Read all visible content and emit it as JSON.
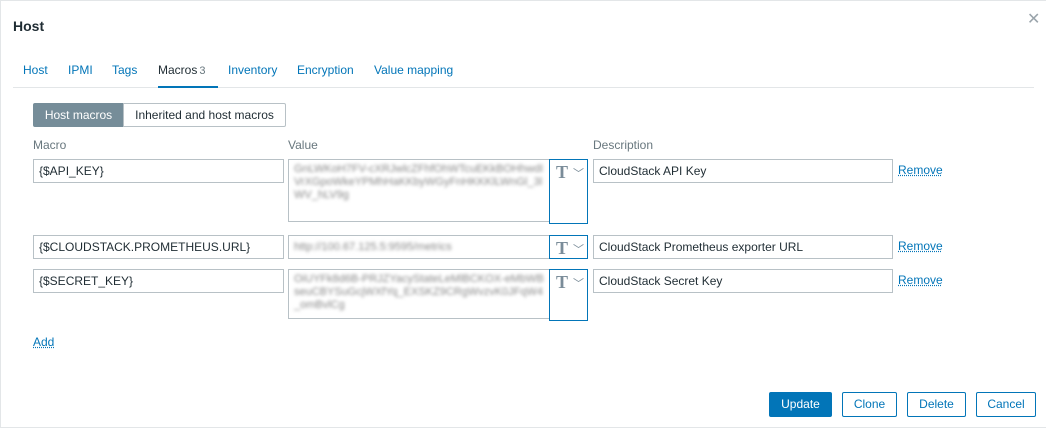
{
  "dialog": {
    "title": "Host"
  },
  "tabs": [
    {
      "label": "Host"
    },
    {
      "label": "IPMI"
    },
    {
      "label": "Tags"
    },
    {
      "label": "Macros",
      "count": "3"
    },
    {
      "label": "Inventory"
    },
    {
      "label": "Encryption"
    },
    {
      "label": "Value mapping"
    }
  ],
  "active_tab": "Macros",
  "segmented": {
    "host_macros": "Host macros",
    "inherited": "Inherited and host macros"
  },
  "columns": {
    "macro": "Macro",
    "value": "Value",
    "description": "Description"
  },
  "macros": [
    {
      "macro": "{$API_KEY}",
      "value": "GnLWKoH7FV-cXRJwlcZFhfOhWTcuEKkBOHhwdIVrXGpoWkeYPMhHaKKbyWGyFnHKKKlLWnGl_3lWV_hLV9g",
      "type": "T",
      "description": "CloudStack API Key",
      "remove": "Remove"
    },
    {
      "macro": "{$CLOUDSTACK.PROMETHEUS.URL}",
      "value": "http://100.67.125.5:9595/metrics",
      "type": "T",
      "description": "CloudStack Prometheus exporter URL",
      "remove": "Remove"
    },
    {
      "macro": "{$SECRET_KEY}",
      "value": "OiUYFk8d6B-PRJZYacyStateLeMlBCKOX-eMbWBseuCBYSuGcjWXfYq_EXSKZ9CRgWvzvK0JFqW4_omBvlCg",
      "type": "T",
      "description": "CloudStack Secret Key",
      "remove": "Remove"
    }
  ],
  "actions": {
    "add": "Add",
    "update": "Update",
    "clone": "Clone",
    "delete": "Delete",
    "cancel": "Cancel"
  },
  "colors": {
    "accent": "#0275b8",
    "segment_active": "#768d99",
    "border": "#b8c1c6"
  }
}
